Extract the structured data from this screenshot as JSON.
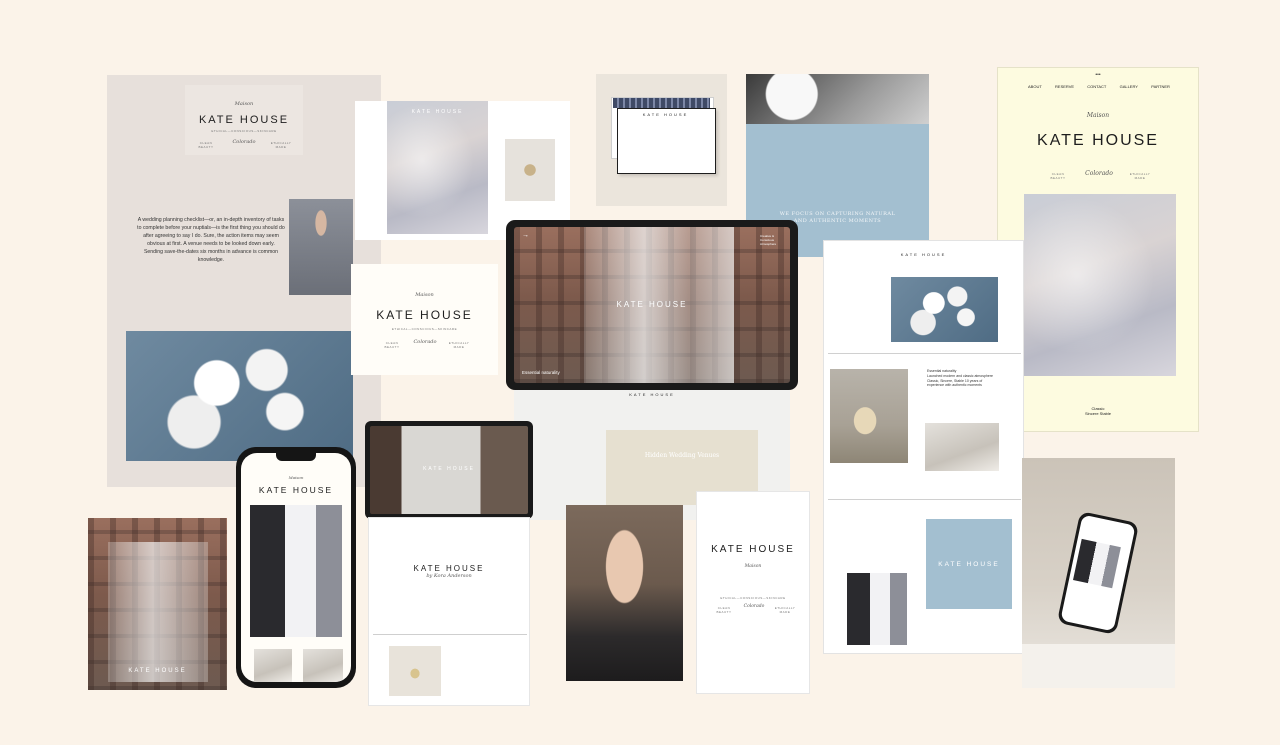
{
  "brand": {
    "name": "KATE HOUSE",
    "tagline": "ETHICAL—CONSCIOUS—SKINCARE",
    "script_top": "Maison",
    "script_mid": "Colorado",
    "col_left": "CLEAN BEAUTY",
    "col_right": "ETHICALLY MADE"
  },
  "poster": {
    "body": "A wedding planning checklist—or, an in-depth inventory of tasks to complete before your nuptials—is the first thing you should do after agreeing to say I do. Sure, the action items may seem obvious at first. A venue needs to be looked down early. Sending save-the-dates six months in advance is common knowledge."
  },
  "site_nav": [
    "ABOUT",
    "RESERVE",
    "CONTACT",
    "GALLERY",
    "PARTNER"
  ],
  "site_footer": [
    "Classic",
    "Sincere Stable"
  ],
  "blue_card": {
    "line1": "WE FOCUS ON CAPTURING NATURAL",
    "line2": "AND AUTHENTIC MOMENTS"
  },
  "tablet": {
    "caption": "Essential naturality",
    "top_right": "Creative & Conscious Atmosphere",
    "brand": "KATE HOUSE"
  },
  "venues": {
    "title": "Hidden Wedding Venues"
  },
  "grid_page": {
    "essential": "Essential naturality",
    "detail": "Launched modern and classic atmosphere Classic, Sincere, Stable 10 years of experience with authentic moments"
  },
  "invitation": {
    "script": "by Kora Anderson"
  },
  "colors": {
    "background": "#fbf3e9",
    "blue": "#a3bfd0",
    "cream": "#fdfbe0"
  }
}
